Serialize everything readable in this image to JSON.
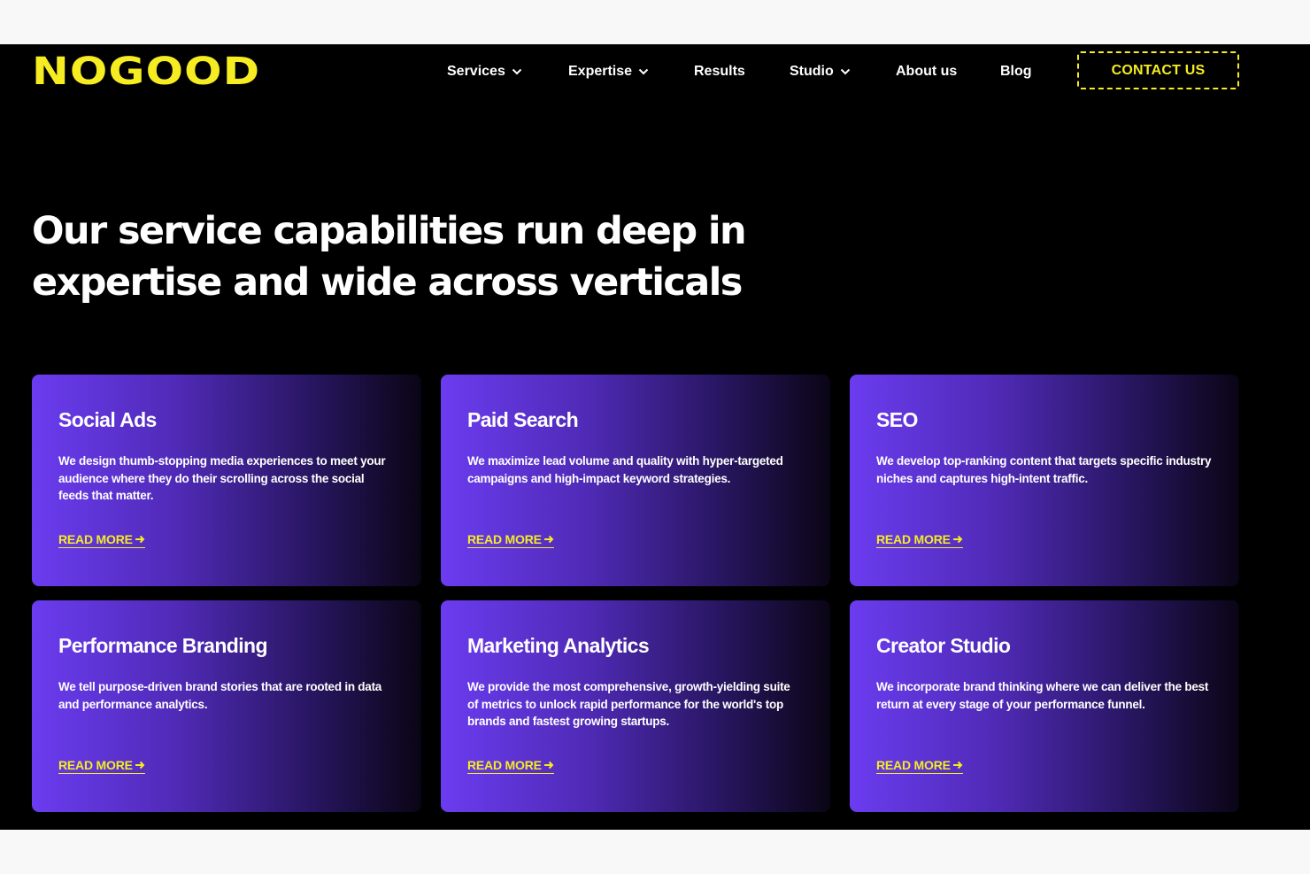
{
  "brand": {
    "logo_text": "NOGOOD",
    "accent_color": "#f5ec22",
    "background_color": "#000000",
    "card_gradient_start": "#6b3cf0"
  },
  "nav": {
    "items": [
      {
        "label": "Services",
        "dropdown": true,
        "icon": "chevron-down-icon"
      },
      {
        "label": "Expertise",
        "dropdown": true,
        "icon": "chevron-down-icon"
      },
      {
        "label": "Results",
        "dropdown": false
      },
      {
        "label": "Studio",
        "dropdown": true,
        "icon": "chevron-down-icon"
      },
      {
        "label": "About us",
        "dropdown": false
      },
      {
        "label": "Blog",
        "dropdown": false
      }
    ],
    "contact_label": "CONTACT US"
  },
  "hero": {
    "headline_line1": "Our service capabilities run deep in",
    "headline_line2": "expertise and wide across verticals"
  },
  "services": [
    {
      "title": "Social Ads",
      "description": "We design thumb-stopping media experiences to meet your audience where they do their scrolling across the social feeds that matter.",
      "link_label": "READ MORE",
      "link_icon": "arrow-right-icon"
    },
    {
      "title": "Paid Search",
      "description": "We maximize lead volume and quality with hyper-targeted campaigns and high-impact keyword strategies.",
      "link_label": "READ MORE",
      "link_icon": "arrow-right-icon"
    },
    {
      "title": "SEO",
      "description": "We develop top-ranking content that targets specific industry niches and captures high-intent traffic.",
      "link_label": "READ MORE",
      "link_icon": "arrow-right-icon"
    },
    {
      "title": "Performance Branding",
      "description": "We tell purpose-driven brand stories that are rooted in data and performance analytics.",
      "link_label": "READ MORE",
      "link_icon": "arrow-right-icon"
    },
    {
      "title": "Marketing Analytics",
      "description": "We provide the most comprehensive, growth-yielding suite of metrics to unlock rapid performance for the world's top brands and fastest growing startups.",
      "link_label": "READ MORE",
      "link_icon": "arrow-right-icon"
    },
    {
      "title": "Creator Studio",
      "description": "We incorporate brand thinking where we can deliver the best return at every stage of your performance funnel.",
      "link_label": "READ MORE",
      "link_icon": "arrow-right-icon"
    }
  ]
}
